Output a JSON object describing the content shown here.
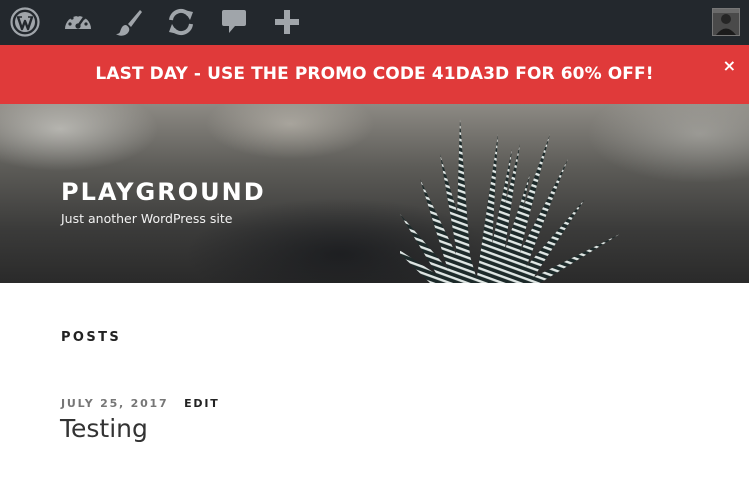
{
  "admin_bar": {
    "items": [
      {
        "icon": "wordpress-logo-icon"
      },
      {
        "icon": "dashboard-icon"
      },
      {
        "icon": "customize-brush-icon"
      },
      {
        "icon": "updates-icon"
      },
      {
        "icon": "comments-icon"
      },
      {
        "icon": "new-content-plus-icon"
      }
    ],
    "avatar": "user-avatar"
  },
  "promo": {
    "text": "LAST DAY - USE THE PROMO CODE 41DA3D FOR 60% OFF!",
    "close": "×",
    "background": "#e03a3a"
  },
  "site": {
    "title": "PLAYGROUND",
    "description": "Just another WordPress site"
  },
  "main": {
    "section_title": "POSTS",
    "posts": [
      {
        "date": "JULY 25, 2017",
        "edit": "EDIT",
        "title": "Testing"
      }
    ]
  },
  "colors": {
    "admin_bar": "#23282d",
    "icon": "#a0a5aa",
    "text_dark": "#222222"
  }
}
